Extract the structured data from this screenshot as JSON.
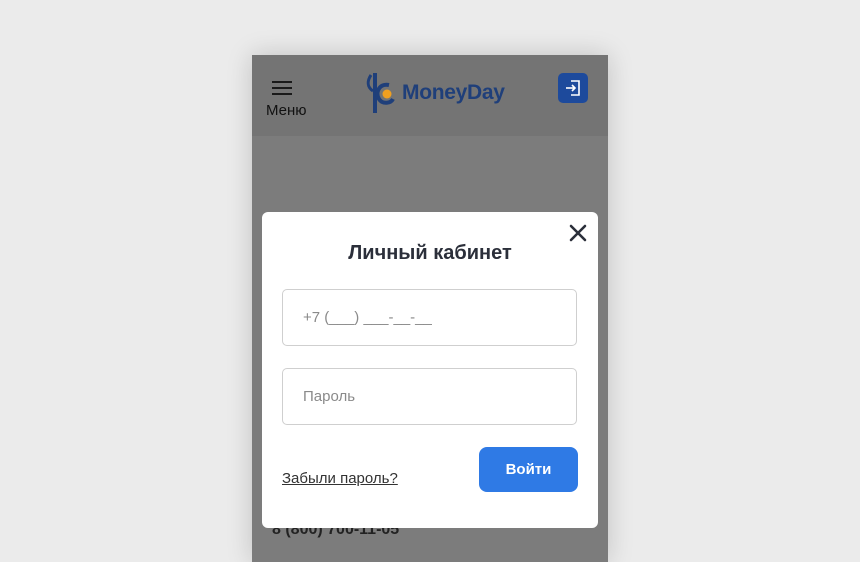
{
  "header": {
    "menu_label": "Меню",
    "brand_name": "MoneyDay",
    "brand_color": "#1f3f7a",
    "accent_orange": "#f0a020",
    "login_icon": "login-icon"
  },
  "page": {
    "phone_number": "8 (800) 700-11-05"
  },
  "modal": {
    "title": "Личный кабинет",
    "phone_placeholder": "+7 (___) ___-__-__",
    "password_placeholder": "Пароль",
    "forgot_label": "Забыли пароль?",
    "submit_label": "Войти",
    "submit_color": "#2f7ae5",
    "close_icon": "close-icon"
  }
}
